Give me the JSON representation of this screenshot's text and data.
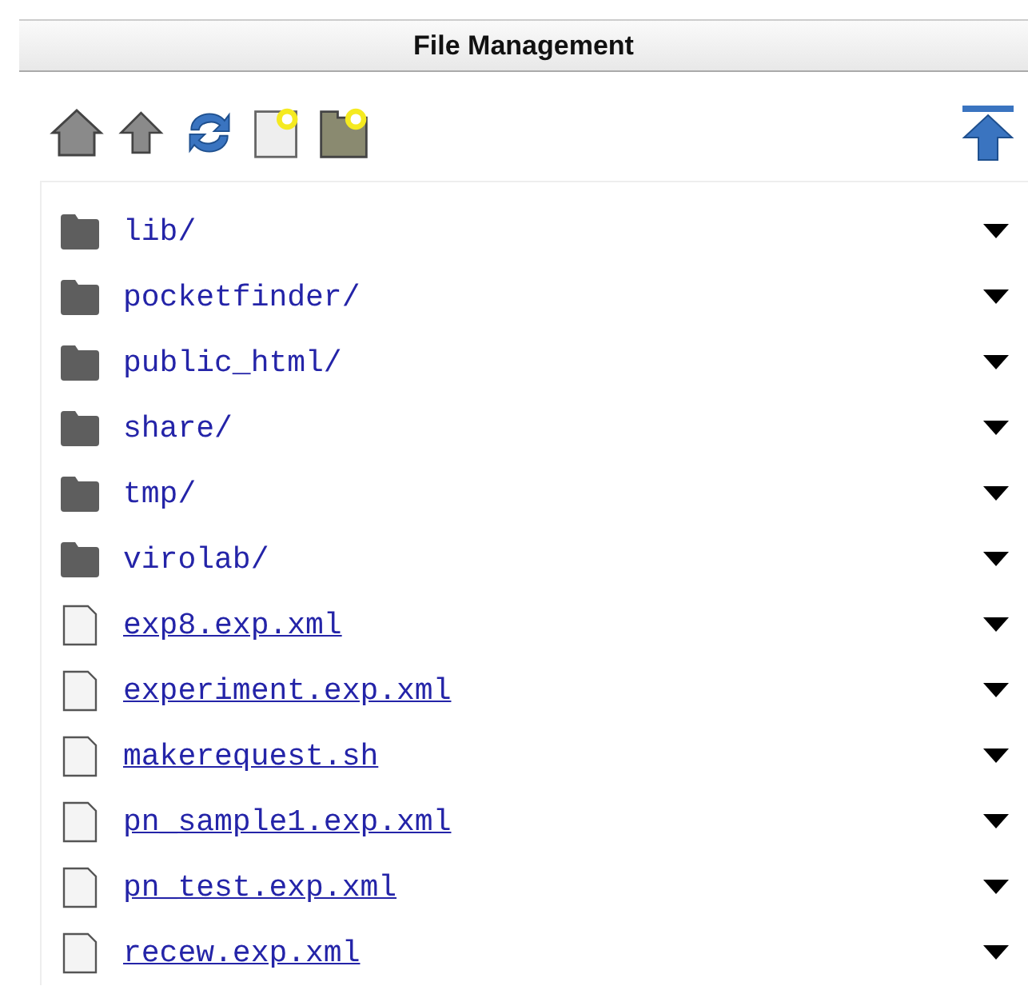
{
  "panel": {
    "title": "File Management"
  },
  "entries": [
    {
      "kind": "folder",
      "name": "lib/"
    },
    {
      "kind": "folder",
      "name": "pocketfinder/"
    },
    {
      "kind": "folder",
      "name": "public_html/"
    },
    {
      "kind": "folder",
      "name": "share/"
    },
    {
      "kind": "folder",
      "name": "tmp/"
    },
    {
      "kind": "folder",
      "name": "virolab/"
    },
    {
      "kind": "file",
      "name": "exp8.exp.xml"
    },
    {
      "kind": "file",
      "name": "experiment.exp.xml"
    },
    {
      "kind": "file",
      "name": "makerequest.sh"
    },
    {
      "kind": "file",
      "name": "pn_sample1.exp.xml"
    },
    {
      "kind": "file",
      "name": "pn_test.exp.xml"
    },
    {
      "kind": "file",
      "name": "recew.exp.xml"
    }
  ]
}
